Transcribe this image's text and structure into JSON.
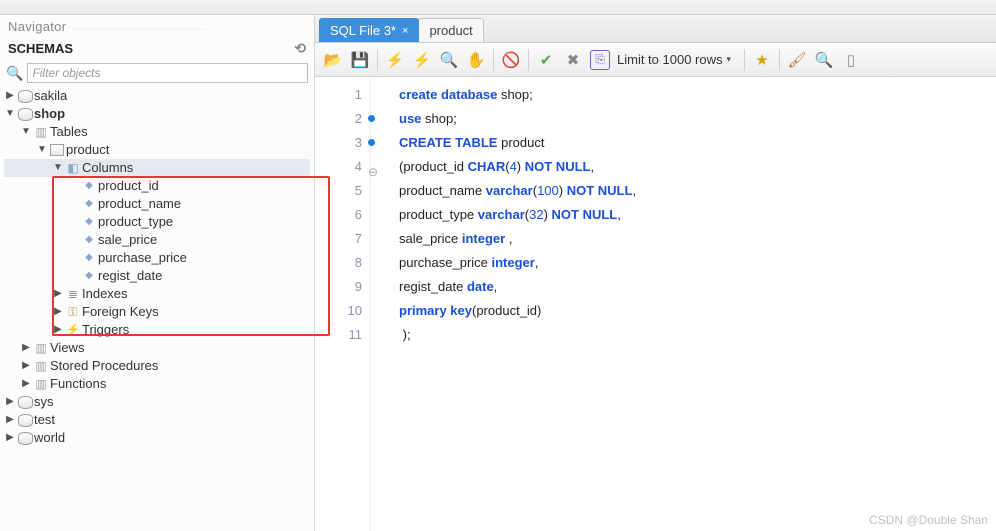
{
  "navigator": {
    "title": "Navigator",
    "schemas_label": "SCHEMAS",
    "filter_placeholder": "Filter objects",
    "tree": {
      "databases": [
        {
          "name": "sakila",
          "expanded": false,
          "bold": false
        },
        {
          "name": "shop",
          "expanded": true,
          "bold": true,
          "children": [
            {
              "name": "Tables",
              "expanded": true,
              "children": [
                {
                  "name": "product",
                  "expanded": true,
                  "children": [
                    {
                      "name": "Columns",
                      "expanded": true,
                      "selected": true,
                      "columns": [
                        "product_id",
                        "product_name",
                        "product_type",
                        "sale_price",
                        "purchase_price",
                        "regist_date"
                      ]
                    },
                    {
                      "name": "Indexes",
                      "expanded": false
                    },
                    {
                      "name": "Foreign Keys",
                      "expanded": false
                    },
                    {
                      "name": "Triggers",
                      "expanded": false
                    }
                  ]
                }
              ]
            },
            {
              "name": "Views",
              "expanded": false
            },
            {
              "name": "Stored Procedures",
              "expanded": false
            },
            {
              "name": "Functions",
              "expanded": false
            }
          ]
        },
        {
          "name": "sys",
          "expanded": false,
          "bold": false
        },
        {
          "name": "test",
          "expanded": false,
          "bold": false
        },
        {
          "name": "world",
          "expanded": false,
          "bold": false
        }
      ]
    }
  },
  "tabs": [
    {
      "label": "SQL File 3*",
      "active": true,
      "closable": true
    },
    {
      "label": "product",
      "active": false,
      "closable": false
    }
  ],
  "toolbar": {
    "limit_label": "Limit to 1000 rows"
  },
  "code": {
    "lines": [
      {
        "n": 1,
        "dot": false,
        "fold": false,
        "tokens": [
          [
            "kw",
            "create"
          ],
          [
            "sp",
            " "
          ],
          [
            "kw",
            "database"
          ],
          [
            "sp",
            " "
          ],
          [
            "ident",
            "shop;"
          ]
        ]
      },
      {
        "n": 2,
        "dot": true,
        "fold": false,
        "tokens": [
          [
            "kw",
            "use"
          ],
          [
            "sp",
            " "
          ],
          [
            "ident",
            "shop;"
          ]
        ]
      },
      {
        "n": 3,
        "dot": true,
        "fold": false,
        "tokens": [
          [
            "kw",
            "CREATE"
          ],
          [
            "sp",
            " "
          ],
          [
            "kw",
            "TABLE"
          ],
          [
            "sp",
            " "
          ],
          [
            "ident",
            "product"
          ]
        ]
      },
      {
        "n": 4,
        "dot": false,
        "fold": true,
        "tokens": [
          [
            "ident",
            "(product_id "
          ],
          [
            "typ",
            "CHAR"
          ],
          [
            "ident",
            "("
          ],
          [
            "num",
            "4"
          ],
          [
            "ident",
            ") "
          ],
          [
            "kw",
            "NOT NULL"
          ],
          [
            "ident",
            ","
          ]
        ]
      },
      {
        "n": 5,
        "dot": false,
        "fold": false,
        "tokens": [
          [
            "ident",
            "product_name "
          ],
          [
            "typ",
            "varchar"
          ],
          [
            "ident",
            "("
          ],
          [
            "num",
            "100"
          ],
          [
            "ident",
            ") "
          ],
          [
            "kw",
            "NOT NULL"
          ],
          [
            "ident",
            ","
          ]
        ]
      },
      {
        "n": 6,
        "dot": false,
        "fold": false,
        "tokens": [
          [
            "ident",
            "product_type "
          ],
          [
            "typ",
            "varchar"
          ],
          [
            "ident",
            "("
          ],
          [
            "num",
            "32"
          ],
          [
            "ident",
            ") "
          ],
          [
            "kw",
            "NOT NULL"
          ],
          [
            "ident",
            ","
          ]
        ]
      },
      {
        "n": 7,
        "dot": false,
        "fold": false,
        "tokens": [
          [
            "ident",
            "sale_price "
          ],
          [
            "typ",
            "integer"
          ],
          [
            "ident",
            " ,"
          ]
        ]
      },
      {
        "n": 8,
        "dot": false,
        "fold": false,
        "tokens": [
          [
            "ident",
            "purchase_price "
          ],
          [
            "typ",
            "integer"
          ],
          [
            "ident",
            ","
          ]
        ]
      },
      {
        "n": 9,
        "dot": false,
        "fold": false,
        "tokens": [
          [
            "ident",
            "regist_date "
          ],
          [
            "typ",
            "date"
          ],
          [
            "ident",
            ","
          ]
        ]
      },
      {
        "n": 10,
        "dot": false,
        "fold": false,
        "tokens": [
          [
            "kw",
            "primary key"
          ],
          [
            "ident",
            "(product_id)"
          ]
        ]
      },
      {
        "n": 11,
        "dot": false,
        "fold": false,
        "tokens": [
          [
            "ident",
            " );"
          ]
        ]
      }
    ]
  },
  "watermark": "CSDN @Double Shan"
}
